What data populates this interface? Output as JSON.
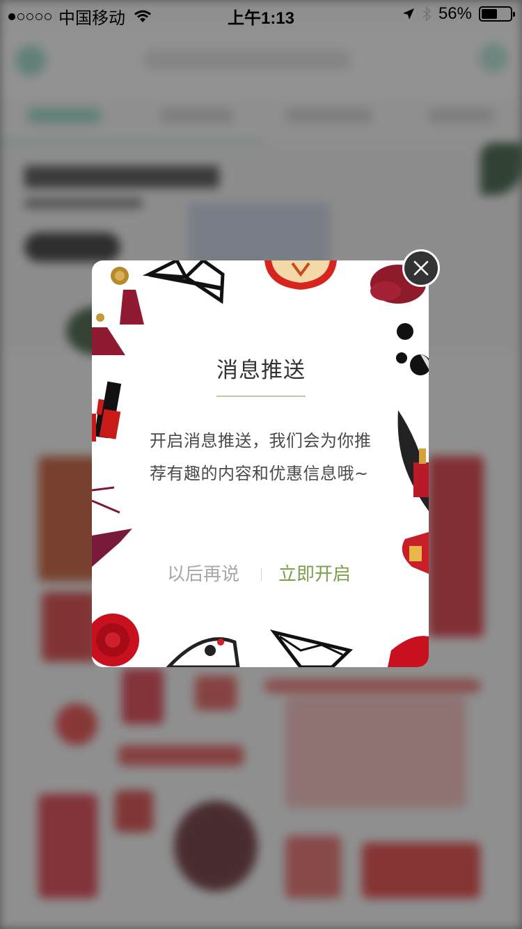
{
  "status_bar": {
    "carrier": "中国移动",
    "time": "上午1:13",
    "battery_percent": "56%",
    "signal_strength": 1,
    "battery_level": 0.56
  },
  "dialog": {
    "title": "消息推送",
    "body": "开启消息推送，我们会为你推荐有趣的内容和优惠信息哦~",
    "later_label": "以后再说",
    "enable_label": "立即开启",
    "close_icon": "close-icon",
    "accent_color": "#7aa04a"
  }
}
